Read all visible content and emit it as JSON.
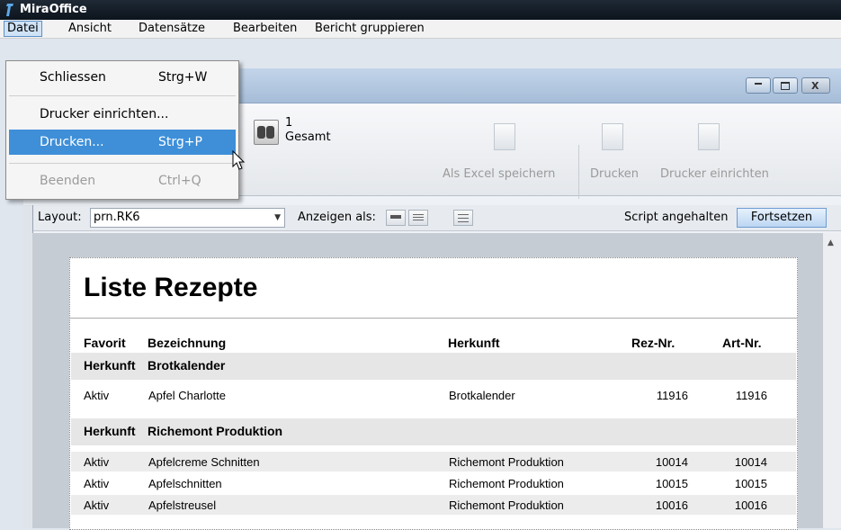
{
  "app": {
    "title": "MiraOffice",
    "icon": "app-icon"
  },
  "menubar": {
    "items": [
      {
        "label": "Datei",
        "active": true
      },
      {
        "label": "Ansicht"
      },
      {
        "label": "Datensätze"
      },
      {
        "label": "Bearbeiten"
      },
      {
        "label": "Bericht gruppieren"
      }
    ]
  },
  "file_menu": {
    "items": [
      {
        "label": "Schliessen",
        "shortcut": "Strg+W"
      },
      {
        "label": "Drucker einrichten...",
        "shortcut": ""
      },
      {
        "label": "Drucken...",
        "shortcut": "Strg+P",
        "highlighted": true
      },
      {
        "label": "Beenden",
        "shortcut": "Ctrl+Q",
        "disabled": true
      }
    ]
  },
  "window": {
    "buttons": [
      "minimize",
      "maximize",
      "close"
    ],
    "close_glyph": "X"
  },
  "toolbar": {
    "record_number": "1",
    "record_total_label": "Gesamt",
    "save_excel_label": "Als Excel speichern",
    "print_label": "Drucken",
    "printer_setup_label": "Drucker einrichten"
  },
  "layoutbar": {
    "layout_label": "Layout:",
    "layout_value": "prn.RK6",
    "view_as_label": "Anzeigen als:",
    "script_status": "Script angehalten",
    "continue_label": "Fortsetzen"
  },
  "report": {
    "title": "Liste Rezepte",
    "columns": [
      "Favorit",
      "Bezeichnung",
      "Herkunft",
      "Rez-Nr.",
      "Art-Nr."
    ],
    "group_key_label": "Herkunft",
    "groups": [
      {
        "name": "Brotkalender",
        "rows": [
          [
            "Aktiv",
            "Apfel Charlotte",
            "Brotkalender",
            "11916",
            "11916"
          ]
        ]
      },
      {
        "name": "Richemont Produktion",
        "rows": [
          [
            "Aktiv",
            "Apfelcreme Schnitten",
            "Richemont Produktion",
            "10014",
            "10014"
          ],
          [
            "Aktiv",
            "Apfelschnitten",
            "Richemont Produktion",
            "10015",
            "10015"
          ],
          [
            "Aktiv",
            "Apfelstreusel",
            "Richemont Produktion",
            "10016",
            "10016"
          ]
        ]
      }
    ]
  },
  "colors": {
    "highlight": "#3e8fd8",
    "titlebar": "#0c141c",
    "continue_button": "#bcd6f2"
  }
}
